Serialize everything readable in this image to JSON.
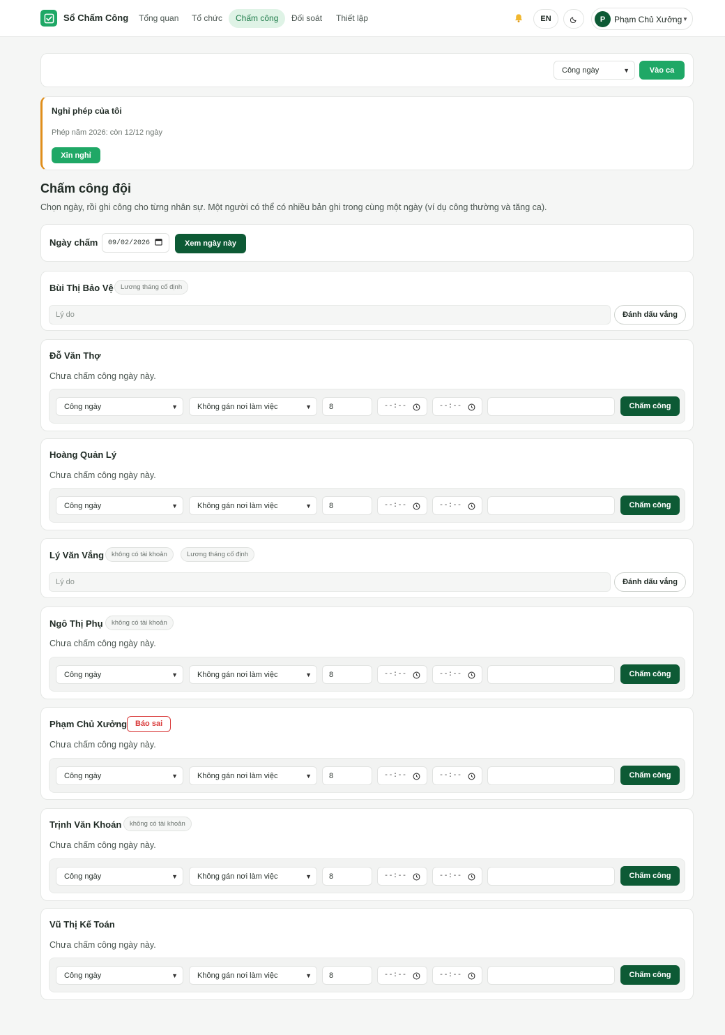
{
  "nav": {
    "brand": "Sổ Chấm Công",
    "items": [
      {
        "label": "Tổng quan"
      },
      {
        "label": "Tổ chức"
      },
      {
        "label": "Chấm công"
      },
      {
        "label": "Đối soát"
      },
      {
        "label": "Thiết lập"
      }
    ],
    "lang": "EN",
    "user_initial": "P",
    "user_name": "Phạm Chủ Xưởng",
    "accent": "#1fa866",
    "dark_accent": "#0d5a35"
  },
  "clockin": {
    "type_value": "Công ngày",
    "button": "Vào ca"
  },
  "leave": {
    "title": "Nghỉ phép của tôi",
    "summary": "Phép năm 2026: còn 12/12 ngày",
    "button": "Xin nghỉ",
    "accent": "#e08e1b"
  },
  "team": {
    "title": "Chấm công đội",
    "description": "Chọn ngày, rồi ghi công cho từng nhân sự. Một người có thể có nhiều bản ghi trong cùng một ngày (ví dụ công thường và tăng ca).",
    "date_label": "Ngày chấm",
    "date_value": "09/02/2026",
    "view_button": "Xem ngày này"
  },
  "common": {
    "status_not_recorded": "Chưa chấm công ngày này.",
    "reason_placeholder": "Lý do",
    "mark_absent": "Đánh dấu vắng",
    "shift_type": "Công ngày",
    "workplace": "Không gán nơi làm việc",
    "hours": "8",
    "time_placeholder": "--:--",
    "submit": "Chấm công",
    "report_wrong": "Báo sai"
  },
  "employees": [
    {
      "name": "Bùi Thị Bảo Vệ",
      "tags": [
        "Lương tháng cố định"
      ]
    },
    {
      "name": "Đỗ Văn Thợ",
      "tags": []
    },
    {
      "name": "Hoàng Quản Lý",
      "tags": []
    },
    {
      "name": "Lý Văn Vắng",
      "tags": [
        "không có tài khoản",
        "Lương tháng cố định"
      ]
    },
    {
      "name": "Ngô Thị Phụ",
      "tags": [
        "không có tài khoản"
      ]
    },
    {
      "name": "Phạm Chủ Xưởng",
      "tags": []
    },
    {
      "name": "Trịnh Văn Khoán",
      "tags": [
        "không có tài khoản"
      ]
    },
    {
      "name": "Vũ Thị Kế Toán",
      "tags": []
    }
  ]
}
